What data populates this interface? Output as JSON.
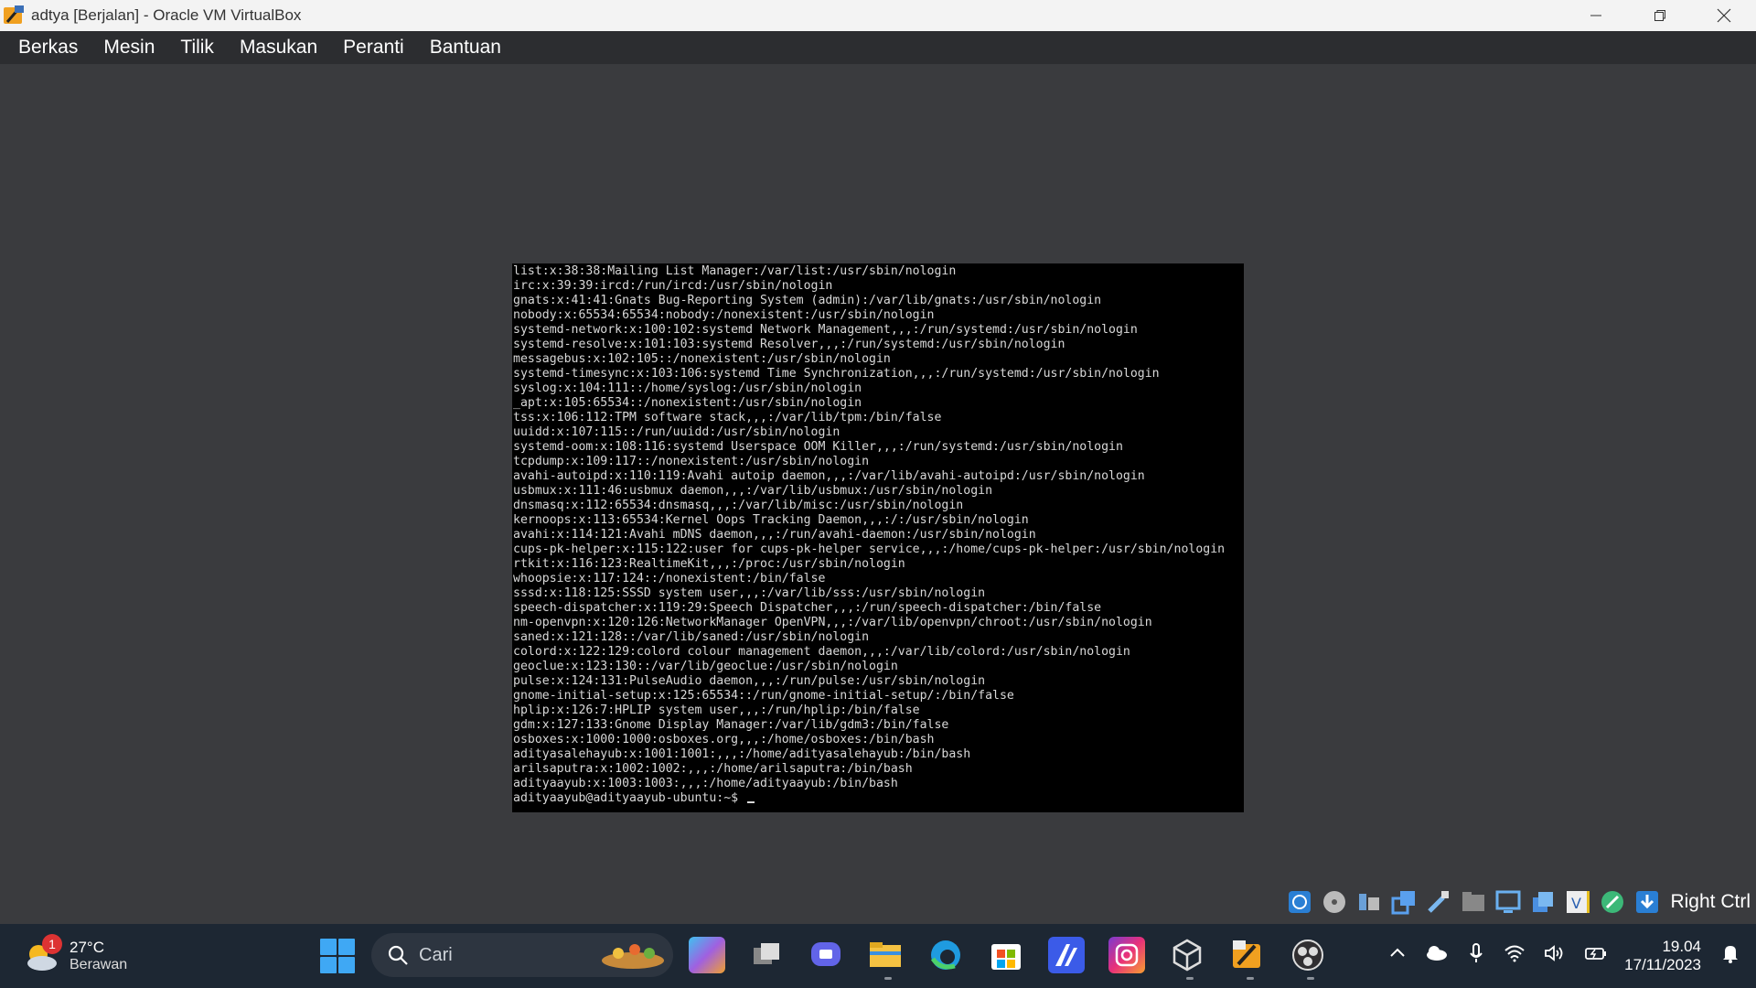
{
  "window": {
    "title": "adtya [Berjalan] - Oracle VM VirtualBox",
    "minimize": "—",
    "maximize": "❐",
    "close": "✕"
  },
  "menu": [
    "Berkas",
    "Mesin",
    "Tilik",
    "Masukan",
    "Peranti",
    "Bantuan"
  ],
  "terminal": {
    "lines": [
      "list:x:38:38:Mailing List Manager:/var/list:/usr/sbin/nologin",
      "irc:x:39:39:ircd:/run/ircd:/usr/sbin/nologin",
      "gnats:x:41:41:Gnats Bug-Reporting System (admin):/var/lib/gnats:/usr/sbin/nologin",
      "nobody:x:65534:65534:nobody:/nonexistent:/usr/sbin/nologin",
      "systemd-network:x:100:102:systemd Network Management,,,:/run/systemd:/usr/sbin/nologin",
      "systemd-resolve:x:101:103:systemd Resolver,,,:/run/systemd:/usr/sbin/nologin",
      "messagebus:x:102:105::/nonexistent:/usr/sbin/nologin",
      "systemd-timesync:x:103:106:systemd Time Synchronization,,,:/run/systemd:/usr/sbin/nologin",
      "syslog:x:104:111::/home/syslog:/usr/sbin/nologin",
      "_apt:x:105:65534::/nonexistent:/usr/sbin/nologin",
      "tss:x:106:112:TPM software stack,,,:/var/lib/tpm:/bin/false",
      "uuidd:x:107:115::/run/uuidd:/usr/sbin/nologin",
      "systemd-oom:x:108:116:systemd Userspace OOM Killer,,,:/run/systemd:/usr/sbin/nologin",
      "tcpdump:x:109:117::/nonexistent:/usr/sbin/nologin",
      "avahi-autoipd:x:110:119:Avahi autoip daemon,,,:/var/lib/avahi-autoipd:/usr/sbin/nologin",
      "usbmux:x:111:46:usbmux daemon,,,:/var/lib/usbmux:/usr/sbin/nologin",
      "dnsmasq:x:112:65534:dnsmasq,,,:/var/lib/misc:/usr/sbin/nologin",
      "kernoops:x:113:65534:Kernel Oops Tracking Daemon,,,:/:/usr/sbin/nologin",
      "avahi:x:114:121:Avahi mDNS daemon,,,:/run/avahi-daemon:/usr/sbin/nologin",
      "cups-pk-helper:x:115:122:user for cups-pk-helper service,,,:/home/cups-pk-helper:/usr/sbin/nologin",
      "rtkit:x:116:123:RealtimeKit,,,:/proc:/usr/sbin/nologin",
      "whoopsie:x:117:124::/nonexistent:/bin/false",
      "sssd:x:118:125:SSSD system user,,,:/var/lib/sss:/usr/sbin/nologin",
      "speech-dispatcher:x:119:29:Speech Dispatcher,,,:/run/speech-dispatcher:/bin/false",
      "nm-openvpn:x:120:126:NetworkManager OpenVPN,,,:/var/lib/openvpn/chroot:/usr/sbin/nologin",
      "saned:x:121:128::/var/lib/saned:/usr/sbin/nologin",
      "colord:x:122:129:colord colour management daemon,,,:/var/lib/colord:/usr/sbin/nologin",
      "geoclue:x:123:130::/var/lib/geoclue:/usr/sbin/nologin",
      "pulse:x:124:131:PulseAudio daemon,,,:/run/pulse:/usr/sbin/nologin",
      "gnome-initial-setup:x:125:65534::/run/gnome-initial-setup/:/bin/false",
      "hplip:x:126:7:HPLIP system user,,,:/run/hplip:/bin/false",
      "gdm:x:127:133:Gnome Display Manager:/var/lib/gdm3:/bin/false",
      "osboxes:x:1000:1000:osboxes.org,,,:/home/osboxes:/bin/bash",
      "adityasalehayub:x:1001:1001:,,,:/home/adityasalehayub:/bin/bash",
      "arilsaputra:x:1002:1002:,,,:/home/arilsaputra:/bin/bash",
      "adityaayub:x:1003:1003:,,,:/home/adityaayub:/bin/bash"
    ],
    "prompt": "adityaayub@adityaayub-ubuntu:~$ "
  },
  "status_bar": {
    "host_key": "Right Ctrl",
    "icons": [
      "hard-disk-icon",
      "optical-drive-icon",
      "audio-icon",
      "network-icon",
      "usb-icon",
      "shared-folder-icon",
      "display-icon",
      "recording-icon",
      "vt-x-icon",
      "mouse-integration-icon",
      "download-icon"
    ]
  },
  "taskbar": {
    "weather": {
      "temp": "27°C",
      "desc": "Berawan",
      "badge": "1"
    },
    "search_placeholder": "Cari",
    "clock": {
      "time": "19.04",
      "date": "17/11/2023"
    }
  },
  "colors": {
    "terminal_bg": "#000000",
    "terminal_fg": "#d8d8d8",
    "vm_bg": "#3a3b3e",
    "menubar_bg": "#2c2d30",
    "taskbar_bg": "#1d2733"
  }
}
